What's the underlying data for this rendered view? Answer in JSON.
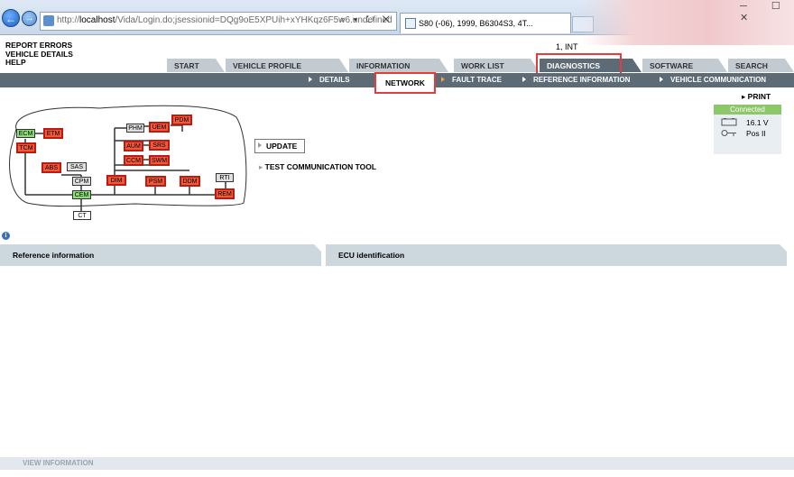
{
  "browser": {
    "url_prefix": "http://",
    "url_host": "localhost",
    "url_path": "/Vida/Login.do;jsessionid=DQg9oE5XPUih+xYHKqz6F5w6.undefined",
    "addr_controls": "⌕ ▾ ↻ ✕",
    "tab_title": "S80 (-06), 1999, B6304S3, 4T...",
    "window_controls": "─ ☐ ✕"
  },
  "user_info": "1, INT",
  "left_links": [
    "REPORT ERRORS",
    "VEHICLE DETAILS",
    "HELP"
  ],
  "main_tabs": [
    "START",
    "VEHICLE PROFILE",
    "INFORMATION",
    "WORK LIST",
    "DIAGNOSTICS",
    "SOFTWARE",
    "SEARCH"
  ],
  "active_main_tab": "DIAGNOSTICS",
  "sub_tabs": [
    "DETAILS",
    "NETWORK",
    "FAULT TRACE",
    "REFERENCE INFORMATION",
    "VEHICLE COMMUNICATION"
  ],
  "active_sub_tab": "NETWORK",
  "print_label": "PRINT",
  "status": {
    "connection": "Connected",
    "voltage": "16.1 V",
    "ignition": "Pos II"
  },
  "network": {
    "modules": {
      "ECM": "ECM",
      "ETM": "ETM",
      "TCM": "TCM",
      "ABS": "ABS",
      "SAS": "SAS",
      "CPM": "CPM",
      "CEM": "CEM",
      "CT": "CT",
      "PHM": "PHM",
      "UEM": "UEM",
      "PDM": "PDM",
      "AUM": "AUM",
      "SRS": "SRS",
      "CCM": "CCM",
      "SWM": "SWM",
      "DIM": "DIM",
      "PSM": "PSM",
      "DDM": "DDM",
      "RTI": "RTI",
      "REM": "REM"
    },
    "status_colors": {
      "fault": "#f05a3c",
      "ok": "#8fdc7a",
      "inactive": "#e0e0e0"
    }
  },
  "actions": {
    "update": "UPDATE",
    "test_comm": "TEST COMMUNICATION TOOL"
  },
  "panels": {
    "left": "Reference information",
    "right": "ECU identification"
  },
  "footer": "VIEW INFORMATION"
}
